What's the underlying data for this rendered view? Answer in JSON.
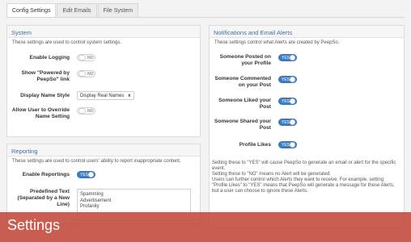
{
  "tabs": [
    "Config Settings",
    "Edit Emails",
    "File System"
  ],
  "system": {
    "title": "System",
    "desc": "These settings are used to control system settings.",
    "enable_logging": {
      "label": "Enable Logging",
      "value": "NO"
    },
    "show_powered_by": {
      "label": "Show \"Powered by PeepSo\" link",
      "value": "NO"
    },
    "display_name_style": {
      "label": "Display Name Style",
      "value": "Display Real Names"
    },
    "allow_override": {
      "label": "Allow User to Override Name Setting",
      "value": "NO"
    }
  },
  "reporting": {
    "title": "Reporting",
    "desc": "These settings are used to control users' ability to report inappropriate content.",
    "enable_reportings": {
      "label": "Enable Reportings",
      "value": "YES"
    },
    "predefined_text": {
      "label": "Predefined Text (Separated by a New Line)",
      "lines": [
        "Spamming",
        "Advertisement",
        "Profanity"
      ]
    }
  },
  "notifications": {
    "title": "Notifications and Email Alerts",
    "desc": "These settings control what Alerts are created by PeepSo.",
    "items": [
      {
        "label": "Someone Posted on your Profile",
        "value": "YES"
      },
      {
        "label": "Someone Commented on your Post",
        "value": "YES"
      },
      {
        "label": "Someone Liked your Post",
        "value": "YES"
      },
      {
        "label": "Someone Shared your Post",
        "value": "YES"
      },
      {
        "label": "Profile Likes",
        "value": "YES"
      }
    ],
    "notes": [
      "Setting these to \"YES\" will cause PeepSo to generate an email or alert for the specific event.",
      "Setting these to \"NO\" means no Alert will be generated.",
      "Users can further control which Alerts they want to receive. For example, setting \"Profile Likes\" to \"YES\" means that PeepSo will generate a message for these Alerts, but a user can choose to ignore these Alerts."
    ]
  },
  "banner": {
    "title": "Settings",
    "color": "#c4483a"
  },
  "colors": {
    "accent": "#3d7dc4",
    "heading": "#3c6fa6"
  }
}
